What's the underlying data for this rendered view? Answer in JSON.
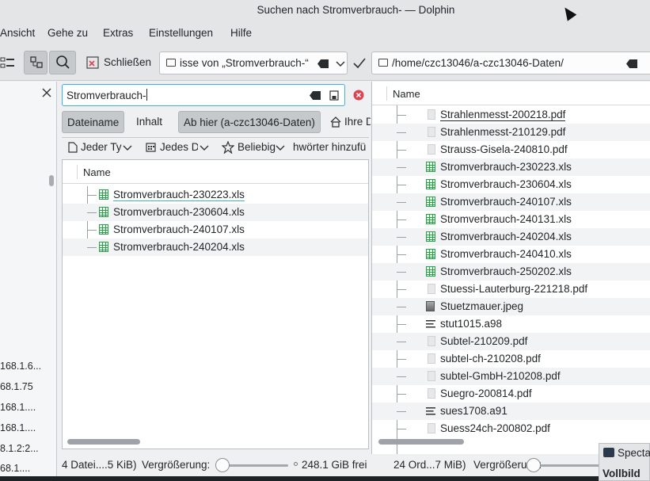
{
  "window": {
    "title": "Suchen nach Stromverbrauch- — Dolphin"
  },
  "menu": {
    "items": [
      "Ansicht",
      "Gehe zu",
      "Extras",
      "Einstellungen",
      "Hilfe"
    ]
  },
  "toolbar": {
    "close_label": "Schließen",
    "left_location": "isse von „Stromverbrauch-“",
    "right_location": "/home/czc13046/a-czc13046-Daten/"
  },
  "places": {
    "items": [
      "168.1.6...",
      "68.1.75",
      "168.1....",
      "168.1....",
      "8.1.2:2...",
      "68.1...."
    ]
  },
  "search": {
    "query": "Stromverbrauch-",
    "tab_filename": "Dateiname",
    "tab_content": "Inhalt",
    "scope_here": "Ab hier (a-czc13046-Daten)",
    "scope_home": "Ihre D",
    "filter_type": "Jeder Ty",
    "filter_date": "Jedes Da",
    "filter_rating": "Beliebig",
    "filter_tags": "hwörter hinzufü"
  },
  "left_list": {
    "header": "Name",
    "rows": [
      "Stromverbrauch-230223.xls",
      "Stromverbrauch-230604.xls",
      "Stromverbrauch-240107.xls",
      "Stromverbrauch-240204.xls"
    ]
  },
  "right_list": {
    "header": "Name",
    "rows": [
      {
        "name": "Strahlenmesst-200218.pdf",
        "icon": "pdf-icon"
      },
      {
        "name": "Strahlenmesst-210129.pdf",
        "icon": "pdf-icon"
      },
      {
        "name": "Strauss-Gisela-240810.pdf",
        "icon": "pdf-icon"
      },
      {
        "name": "Stromverbrauch-230223.xls",
        "icon": "spreadsheet-icon"
      },
      {
        "name": "Stromverbrauch-230604.xls",
        "icon": "spreadsheet-icon"
      },
      {
        "name": "Stromverbrauch-240107.xls",
        "icon": "spreadsheet-icon"
      },
      {
        "name": "Stromverbrauch-240131.xls",
        "icon": "spreadsheet-icon"
      },
      {
        "name": "Stromverbrauch-240204.xls",
        "icon": "spreadsheet-icon"
      },
      {
        "name": "Stromverbrauch-240410.xls",
        "icon": "spreadsheet-icon"
      },
      {
        "name": "Stromverbrauch-250202.xls",
        "icon": "spreadsheet-icon"
      },
      {
        "name": "Stuessi-Lauterburg-221218.pdf",
        "icon": "pdf-icon"
      },
      {
        "name": "Stuetzmauer.jpeg",
        "icon": "image-icon"
      },
      {
        "name": "stut1015.a98",
        "icon": "text-icon"
      },
      {
        "name": "Subtel-210209.pdf",
        "icon": "pdf-icon"
      },
      {
        "name": "subtel-ch-210208.pdf",
        "icon": "pdf-icon"
      },
      {
        "name": "subtel-GmbH-210208.pdf",
        "icon": "pdf-icon"
      },
      {
        "name": "Suegro-200814.pdf",
        "icon": "pdf-icon"
      },
      {
        "name": "sues1708.a91",
        "icon": "text-icon"
      },
      {
        "name": "Suess24ch-200802.pdf",
        "icon": "pdf-icon"
      }
    ]
  },
  "status": {
    "left_info": "4 Datei....5 KiB)",
    "zoom_label": "Vergrößerung:",
    "free_space": "248.1 GiB frei",
    "right_info": "24 Ord...7 MiB)",
    "zoom_label2": "Vergrößerung:"
  },
  "taskbar": {
    "app_label": "Specta",
    "mode_label": "Vollbild"
  },
  "colors": {
    "accent": "#3daee9",
    "spreadsheet": "#2e9e4d",
    "close_red": "#da4453"
  }
}
